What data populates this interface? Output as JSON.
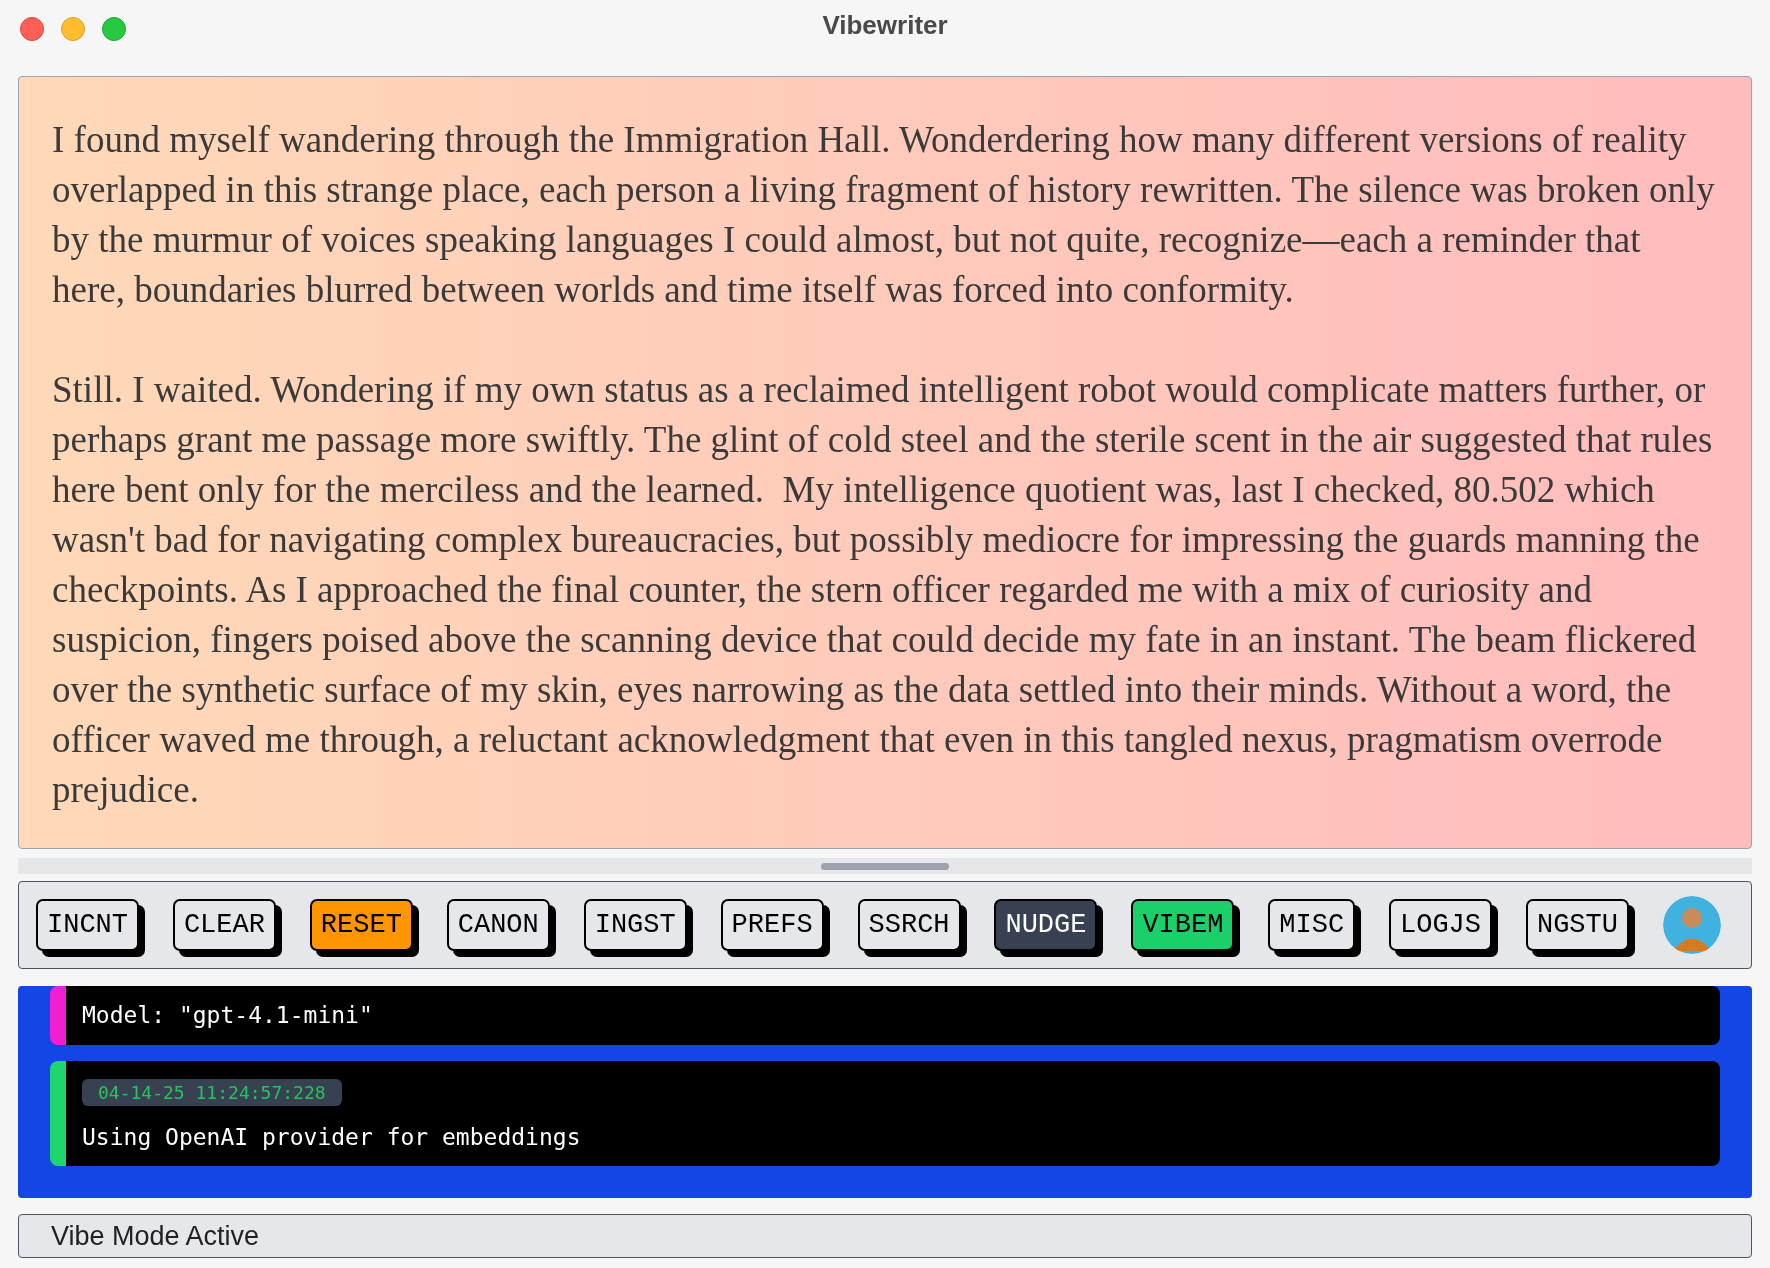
{
  "window": {
    "title": "Vibewriter"
  },
  "editor": {
    "paragraphs": [
      "I found myself wandering through the Immigration Hall. Wonderdering how many different versions of reality overlapped in this strange place, each person a living fragment of history rewritten. The silence was broken only by the murmur of voices speaking languages I could almost, but not quite, recognize—each a reminder that here, boundaries blurred between worlds and time itself was forced into conformity.",
      "Still. I waited. Wondering if my own status as a reclaimed intelligent robot would complicate matters further, or perhaps grant me passage more swiftly. The glint of cold steel and the sterile scent in the air suggested that rules here bent only for the merciless and the learned.  My intelligence quotient was, last I checked, 80.502 which wasn't bad for navigating complex bureaucracies, but possibly mediocre for impressing the guards manning the checkpoints. As I approached the final counter, the stern officer regarded me with a mix of curiosity and suspicion, fingers poised above the scanning device that could decide my fate in an instant. The beam flickered over the synthetic surface of my skin, eyes narrowing as the data settled into their minds. Without a word, the officer waved me through, a reluctant acknowledgment that even in this tangled nexus, pragmatism overrode prejudice."
    ]
  },
  "toolbar": {
    "buttons": [
      {
        "label": "INCNT",
        "kind": "plain"
      },
      {
        "label": "CLEAR",
        "kind": "plain"
      },
      {
        "label": "RESET",
        "kind": "orange"
      },
      {
        "label": "CANON",
        "kind": "plain"
      },
      {
        "label": "INGST",
        "kind": "plain"
      },
      {
        "label": "PREFS",
        "kind": "plain"
      },
      {
        "label": "SSRCH",
        "kind": "plain"
      },
      {
        "label": "NUDGE",
        "kind": "dark"
      },
      {
        "label": "VIBEM",
        "kind": "green"
      },
      {
        "label": "MISC",
        "kind": "plain"
      },
      {
        "label": "LOGJS",
        "kind": "plain"
      },
      {
        "label": "NGSTU",
        "kind": "plain"
      }
    ]
  },
  "log": {
    "entries": [
      {
        "color": "#f01fd0",
        "message": "Model: \"gpt-4.1-mini\""
      },
      {
        "color": "#1fd66e",
        "timestamp": "04-14-25 11:24:57:228",
        "message": "Using OpenAI provider for embeddings"
      }
    ]
  },
  "status_bar": {
    "text": "Vibe Mode Active"
  }
}
